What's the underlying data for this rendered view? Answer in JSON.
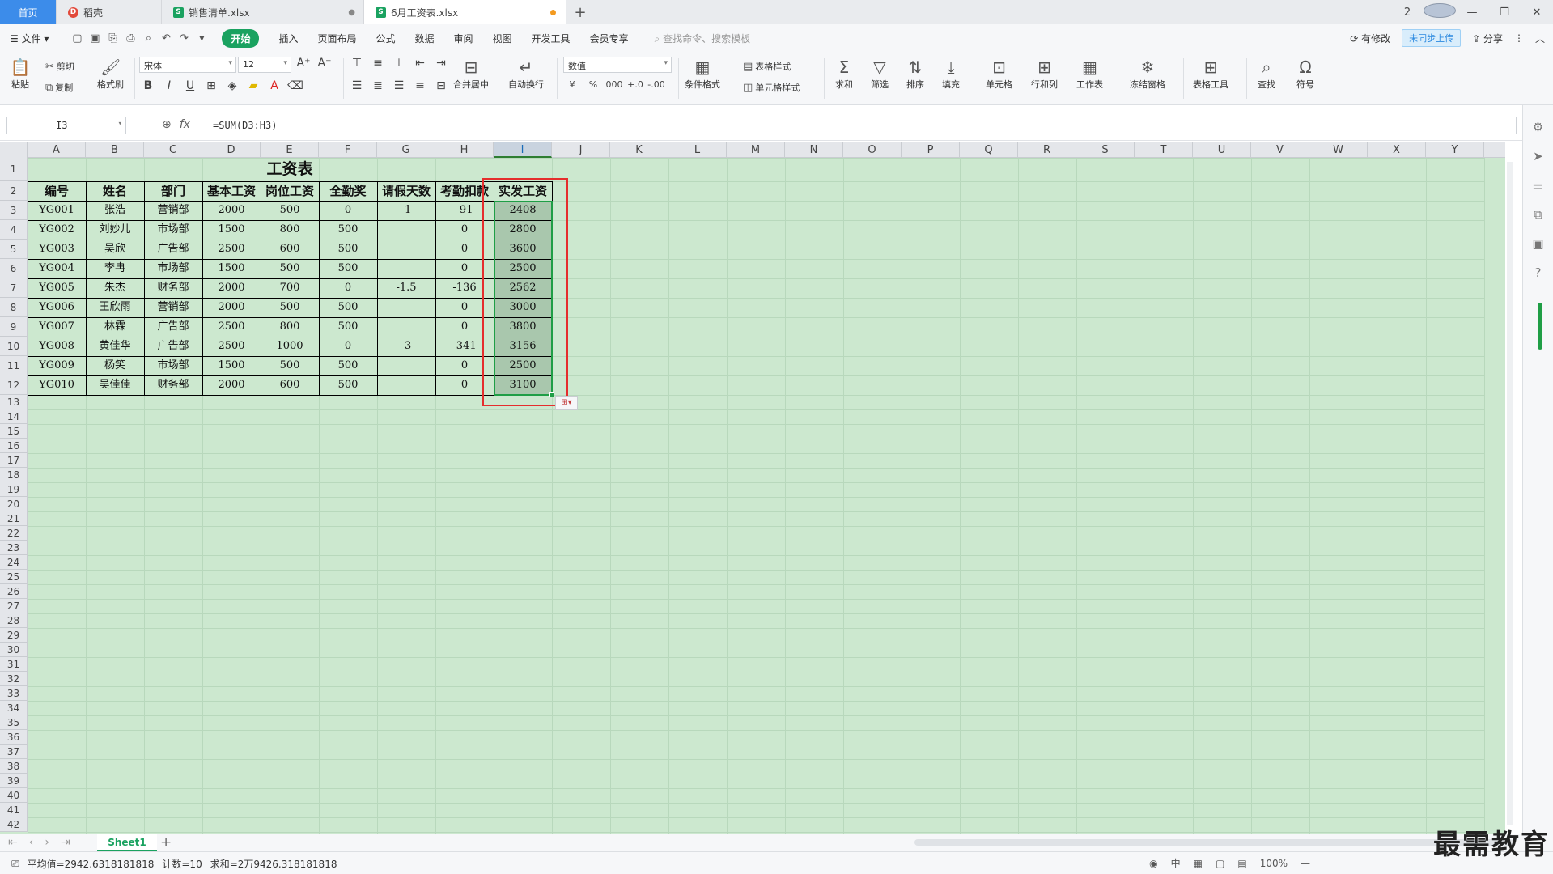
{
  "tabs": {
    "home": "首页",
    "docer": "稻壳",
    "file1": "销售清单.xlsx",
    "file2": "6月工资表.xlsx",
    "add": "+"
  },
  "window": {
    "page_badge": "2",
    "minimize": "—",
    "restore": "❐",
    "close": "✕"
  },
  "menu": {
    "file": "文件",
    "items": [
      "开始",
      "插入",
      "页面布局",
      "公式",
      "数据",
      "审阅",
      "视图",
      "开发工具",
      "会员专享"
    ],
    "search_placeholder": "查找命令、搜索模板",
    "right": {
      "unsaved": "有修改",
      "cloud": "未同步上传",
      "share": "分享"
    }
  },
  "ribbon": {
    "paste": "粘贴",
    "cut": "剪切",
    "copy": "复制",
    "format_painter": "格式刷",
    "font_name": "宋体",
    "font_size": "12",
    "merge_center": "合并居中",
    "wrap_text": "自动换行",
    "number_format": "数值",
    "conditional_format": "条件格式",
    "table_style": "表格样式",
    "cell_style": "单元格样式",
    "sum": "求和",
    "filter": "筛选",
    "sort": "排序",
    "fill": "填充",
    "cell": "单元格",
    "row_col": "行和列",
    "worksheet": "工作表",
    "freeze": "冻结窗格",
    "table_tools": "表格工具",
    "find": "查找",
    "symbol": "符号",
    "currency": "¥",
    "percent": "%",
    "thousands": "000",
    "dec_inc": "+.0",
    "dec_dec": "-.00"
  },
  "formula_bar": {
    "name_box": "I3",
    "formula": "=SUM(D3:H3)"
  },
  "columns": [
    "A",
    "B",
    "C",
    "D",
    "E",
    "F",
    "G",
    "H",
    "I",
    "J",
    "K",
    "L",
    "M",
    "N",
    "O",
    "P",
    "Q",
    "R",
    "S",
    "T",
    "U",
    "V",
    "W",
    "X",
    "Y"
  ],
  "rows": [
    "1",
    "2",
    "3",
    "4",
    "5",
    "6",
    "7",
    "8",
    "9",
    "10",
    "11",
    "12",
    "13",
    "14",
    "15",
    "16",
    "17",
    "18",
    "19",
    "20",
    "21",
    "22",
    "23",
    "24",
    "25",
    "26",
    "27",
    "28",
    "29",
    "30",
    "31",
    "32",
    "33",
    "34",
    "35",
    "36",
    "37",
    "38",
    "39",
    "40",
    "41",
    "42"
  ],
  "sheet": {
    "title": "工资表",
    "headers": [
      "编号",
      "姓名",
      "部门",
      "基本工资",
      "岗位工资",
      "全勤奖",
      "请假天数",
      "考勤扣款",
      "实发工资"
    ],
    "data": [
      [
        "YG001",
        "张浩",
        "营销部",
        "2000",
        "500",
        "0",
        "-1",
        "-91",
        "2408"
      ],
      [
        "YG002",
        "刘妙儿",
        "市场部",
        "1500",
        "800",
        "500",
        "",
        "0",
        "2800"
      ],
      [
        "YG003",
        "吴欣",
        "广告部",
        "2500",
        "600",
        "500",
        "",
        "0",
        "3600"
      ],
      [
        "YG004",
        "李冉",
        "市场部",
        "1500",
        "500",
        "500",
        "",
        "0",
        "2500"
      ],
      [
        "YG005",
        "朱杰",
        "财务部",
        "2000",
        "700",
        "0",
        "-1.5",
        "-136",
        "2562"
      ],
      [
        "YG006",
        "王欣雨",
        "营销部",
        "2000",
        "500",
        "500",
        "",
        "0",
        "3000"
      ],
      [
        "YG007",
        "林霖",
        "广告部",
        "2500",
        "800",
        "500",
        "",
        "0",
        "3800"
      ],
      [
        "YG008",
        "黄佳华",
        "广告部",
        "2500",
        "1000",
        "0",
        "-3",
        "-341",
        "3156"
      ],
      [
        "YG009",
        "杨笑",
        "市场部",
        "1500",
        "500",
        "500",
        "",
        "0",
        "2500"
      ],
      [
        "YG010",
        "吴佳佳",
        "财务部",
        "2000",
        "600",
        "500",
        "",
        "0",
        "3100"
      ]
    ]
  },
  "sheet_tabs": {
    "active": "Sheet1",
    "add": "+"
  },
  "status": {
    "average": "平均值=2942.6318181818",
    "count": "计数=10",
    "sum": "求和=2万9426.318181818",
    "zoom": "100%"
  },
  "watermark": "最需教育",
  "colors": {
    "grid_bg": "#cce8cf",
    "accent": "#1aa260",
    "annotation": "#e52d2d"
  }
}
